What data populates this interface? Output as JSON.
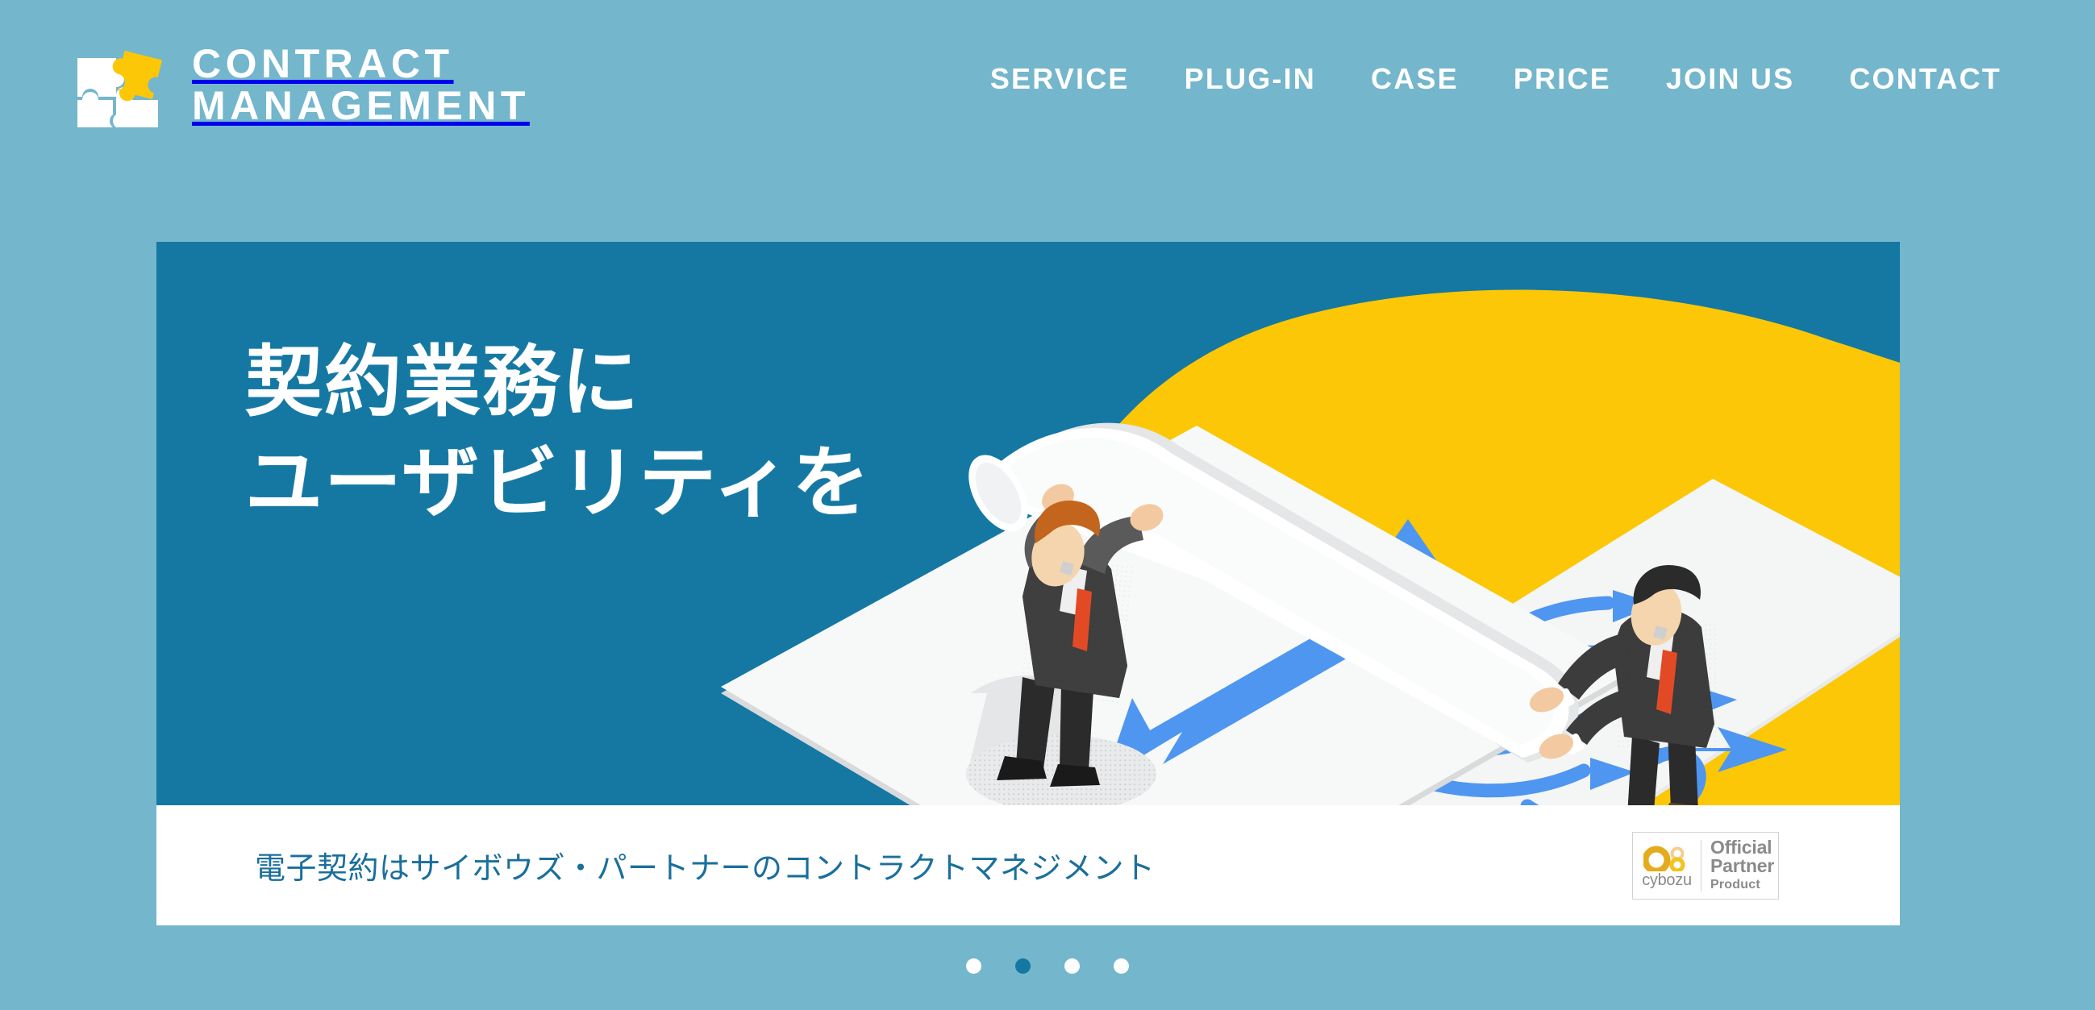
{
  "theme": {
    "page_bg": "#74b6cc",
    "panel_bg": "#1478a3",
    "accent_yellow": "#fbc707",
    "arrow_blue": "#4e96f0",
    "caption_text": "#1a6f9c",
    "white": "#ffffff",
    "badge_gray": "#8a8a8a"
  },
  "header": {
    "logo": {
      "icon": "puzzle-pieces-icon",
      "line1": "CONTRACT",
      "line2": "MANAGEMENT"
    },
    "nav": [
      {
        "label": "SERVICE",
        "name": "nav-service"
      },
      {
        "label": "PLUG-IN",
        "name": "nav-plugin"
      },
      {
        "label": "CASE",
        "name": "nav-case"
      },
      {
        "label": "PRICE",
        "name": "nav-price"
      },
      {
        "label": "JOIN US",
        "name": "nav-join-us"
      },
      {
        "label": "CONTACT",
        "name": "nav-contact"
      }
    ]
  },
  "hero": {
    "headline_line1": "契約業務に",
    "headline_line2": "ユーザビリティを",
    "caption": "電子契約はサイボウズ・パートナーのコントラクトマネジメント",
    "illustration": "isometric-businessmen-unrolling-paper-illustration",
    "badge": {
      "brand": "cybozu",
      "line1": "Official",
      "line2": "Partner",
      "line3": "Product"
    }
  },
  "carousel": {
    "total": 4,
    "active_index": 1,
    "dots": [
      "1",
      "2",
      "3",
      "4"
    ]
  }
}
